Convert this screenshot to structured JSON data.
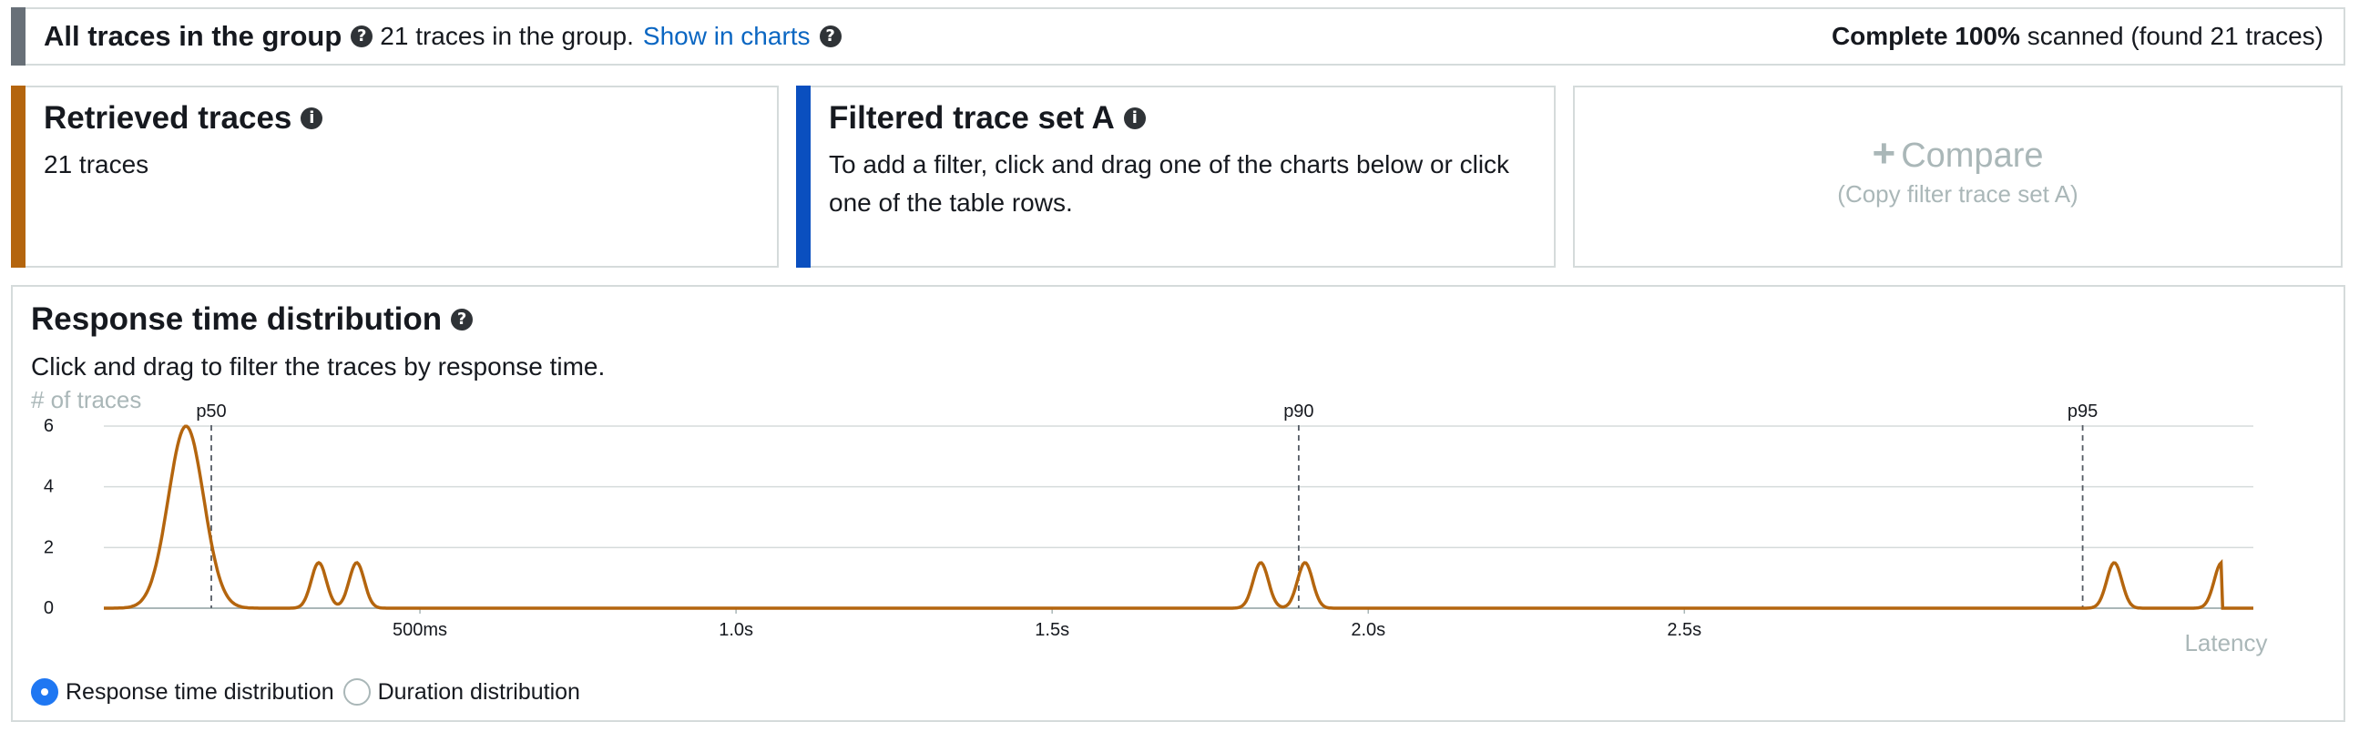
{
  "group_bar": {
    "title": "All traces in the group",
    "count_text": "21 traces in the group.",
    "link_label": "Show in charts",
    "status_bold": "Complete 100%",
    "status_rest": "scanned (found 21 traces)"
  },
  "retrieved": {
    "title": "Retrieved traces",
    "body": "21 traces",
    "accent": "#b4650e"
  },
  "filtered": {
    "title": "Filtered trace set A",
    "body": "To add a filter, click and drag one of the charts below or click one of the table rows.",
    "accent": "#0a4fbf"
  },
  "compare": {
    "plus": "+",
    "label": "Compare",
    "sub": "(Copy filter trace set A)"
  },
  "distribution": {
    "title": "Response time distribution",
    "description": "Click and drag to filter the traces by response time.",
    "radios": [
      {
        "label": "Response time distribution",
        "checked": true
      },
      {
        "label": "Duration distribution",
        "checked": false
      }
    ]
  },
  "chart_data": {
    "type": "line",
    "ylabel": "# of traces",
    "xlabel": "Latency",
    "y_ticks": [
      0,
      2,
      4,
      6
    ],
    "ylim": [
      0,
      6
    ],
    "xlim": [
      0,
      3.4
    ],
    "x_ticks": [
      {
        "value": 0.5,
        "label": "500ms"
      },
      {
        "value": 1.0,
        "label": "1.0s"
      },
      {
        "value": 1.5,
        "label": "1.5s"
      },
      {
        "value": 2.0,
        "label": "2.0s"
      },
      {
        "value": 2.5,
        "label": "2.5s"
      }
    ],
    "percentiles": [
      {
        "label": "p50",
        "value": 0.17
      },
      {
        "label": "p90",
        "value": 1.89
      },
      {
        "label": "p95",
        "value": 3.13
      }
    ],
    "peaks": [
      {
        "x": 0.13,
        "y": 6
      },
      {
        "x": 0.34,
        "y": 1.5
      },
      {
        "x": 0.4,
        "y": 1.5
      },
      {
        "x": 1.83,
        "y": 1.5
      },
      {
        "x": 1.9,
        "y": 1.5
      },
      {
        "x": 3.18,
        "y": 1.5
      },
      {
        "x": 3.35,
        "y": 1.5
      }
    ],
    "color": "#b4650e"
  }
}
